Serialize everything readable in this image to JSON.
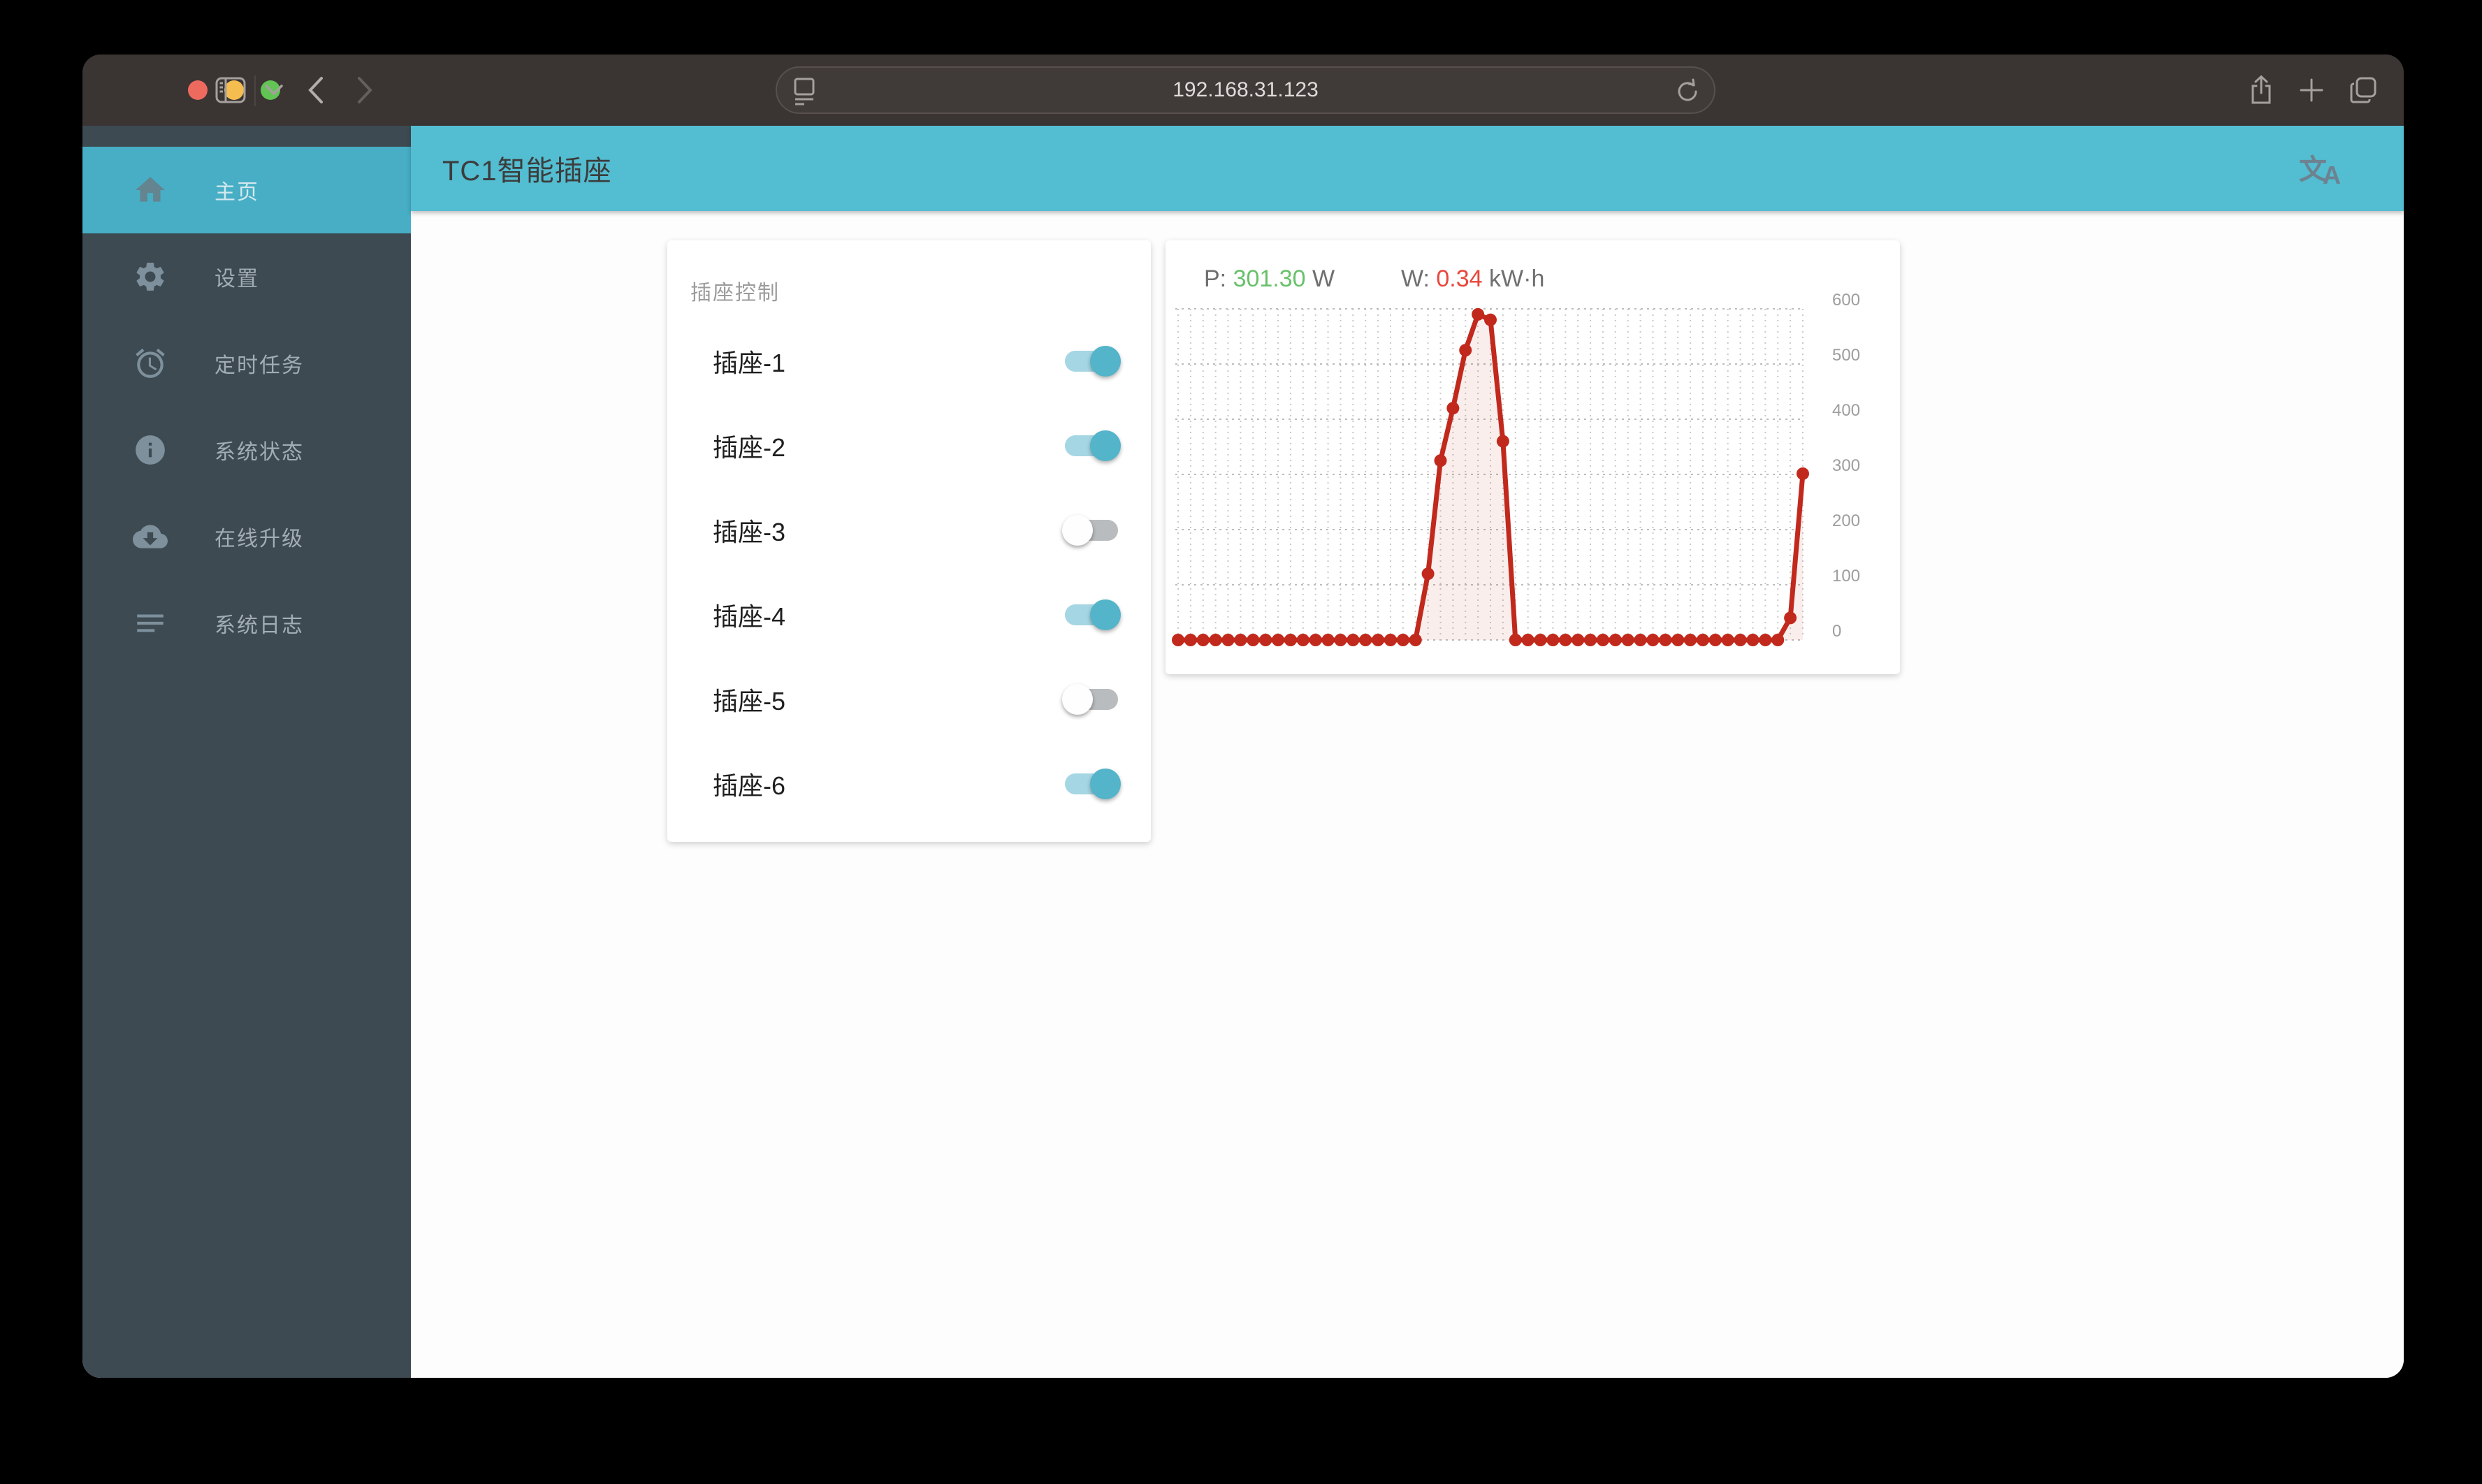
{
  "browser": {
    "url": "192.168.31.123",
    "icons": {
      "traffic": [
        "close",
        "minimize",
        "zoom"
      ],
      "left": [
        "sidebar-toggle",
        "chevron-down",
        "back",
        "forward"
      ],
      "url_left": "page-icon",
      "url_right": "reload-icon",
      "right": [
        "share",
        "new-tab",
        "tab-overview"
      ]
    }
  },
  "appbar": {
    "title": "TC1智能插座",
    "right_icon": "translate-icon"
  },
  "sidebar": {
    "items": [
      {
        "label": "主页",
        "icon": "home",
        "active": true
      },
      {
        "label": "设置",
        "icon": "settings",
        "active": false
      },
      {
        "label": "定时任务",
        "icon": "alarm",
        "active": false
      },
      {
        "label": "系统状态",
        "icon": "info",
        "active": false
      },
      {
        "label": "在线升级",
        "icon": "cloud-download",
        "active": false
      },
      {
        "label": "系统日志",
        "icon": "log",
        "active": false
      }
    ]
  },
  "socket_card": {
    "title": "插座控制",
    "switches": [
      {
        "label": "插座-1",
        "on": true
      },
      {
        "label": "插座-2",
        "on": true
      },
      {
        "label": "插座-3",
        "on": false
      },
      {
        "label": "插座-4",
        "on": true
      },
      {
        "label": "插座-5",
        "on": false
      },
      {
        "label": "插座-6",
        "on": true
      }
    ]
  },
  "chart_card": {
    "power_label": "P:",
    "power_value": "301.30",
    "power_unit": " W",
    "energy_label": "W:",
    "energy_value": "0.34",
    "energy_unit": " kW·h"
  },
  "chart_data": {
    "type": "line",
    "title": "realtime power",
    "xlabel": "",
    "ylabel": "",
    "ylim": [
      0,
      600
    ],
    "yticks": [
      0,
      100,
      200,
      300,
      400,
      500,
      600
    ],
    "grid": "dotted",
    "legend_position": "none",
    "series": [
      {
        "name": "power-w",
        "values": [
          0,
          0,
          0,
          0,
          0,
          0,
          0,
          0,
          0,
          0,
          0,
          0,
          0,
          0,
          0,
          0,
          0,
          0,
          0,
          0,
          120,
          325,
          420,
          525,
          590,
          580,
          360,
          0,
          0,
          0,
          0,
          0,
          0,
          0,
          0,
          0,
          0,
          0,
          0,
          0,
          0,
          0,
          0,
          0,
          0,
          0,
          0,
          0,
          0,
          40,
          301.3
        ]
      }
    ],
    "colors": {
      "line": "#c1291d",
      "fill": "rgba(197,43,31,0.08)",
      "grid": "#c9c9c9",
      "tick_text": "#9e9e9e",
      "power_green": "#68c16a",
      "energy_red": "#e8473b"
    }
  }
}
